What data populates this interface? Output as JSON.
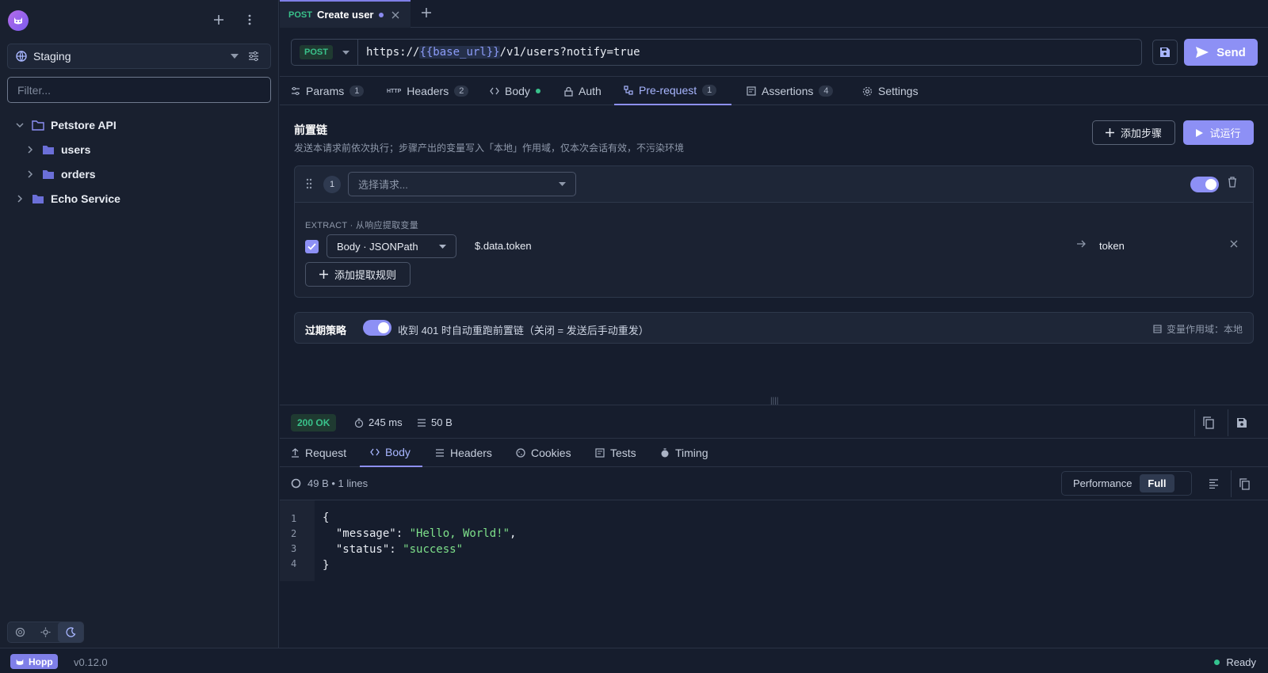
{
  "app": {
    "version": "v0.12.0",
    "brand": "Hopp",
    "status": "Ready"
  },
  "sidebar": {
    "environment": "Staging",
    "filter_placeholder": "Filter...",
    "tree": [
      {
        "label": "Petstore API"
      },
      {
        "label": "users"
      },
      {
        "label": "orders"
      },
      {
        "label": "Echo Service"
      }
    ]
  },
  "tab": {
    "method": "POST",
    "title": "Create user"
  },
  "request": {
    "method": "POST",
    "url_prefix": "https://",
    "url_var": "{{base_url}}",
    "url_suffix": "/v1/users?notify=true",
    "send_label": "Send"
  },
  "request_tabs": [
    {
      "label": "Params",
      "count": "1"
    },
    {
      "label": "Headers",
      "count": "2"
    },
    {
      "label": "Body"
    },
    {
      "label": "Auth"
    },
    {
      "label": "Pre-request",
      "count": "1"
    },
    {
      "label": "Assertions",
      "count": "4"
    },
    {
      "label": "Settings"
    }
  ],
  "prerequest": {
    "title": "前置链",
    "subtitle": "发送本请求前依次执行；步骤产出的变量写入「本地」作用域，仅本次会话有效，不污染环境",
    "add_step_label": "添加步骤",
    "dry_run_label": "试运行",
    "step": {
      "number": "1",
      "select_placeholder": "选择请求...",
      "enabled": true,
      "extract_label": "EXTRACT · 从响应提取变量",
      "rule": {
        "checked": true,
        "source": "Body · JSONPath",
        "path": "$.data.token",
        "variable": "token"
      },
      "add_rule_label": "添加提取规则"
    },
    "expiry": {
      "title": "过期策略",
      "enabled": true,
      "description": "收到 401 时自动重跑前置链（关闭 = 发送后手动重发）",
      "scope": "变量作用域：本地"
    }
  },
  "response": {
    "status": "200 OK",
    "time": "245 ms",
    "size": "50 B",
    "tabs": [
      {
        "label": "Request"
      },
      {
        "label": "Body"
      },
      {
        "label": "Headers"
      },
      {
        "label": "Cookies"
      },
      {
        "label": "Tests"
      },
      {
        "label": "Timing"
      }
    ],
    "body_info": "49 B • 1 lines",
    "view_modes": [
      "Performance",
      "Full"
    ],
    "active_view": "Full",
    "lines": [
      {
        "n": "1",
        "text": "{"
      },
      {
        "n": "2",
        "key": "  \"message\": ",
        "value": "\"Hello, World!\"",
        "tail": ","
      },
      {
        "n": "3",
        "key": "  \"status\": ",
        "value": "\"success\""
      },
      {
        "n": "4",
        "text": "}"
      }
    ]
  },
  "colors": {
    "accent": "#8d90f5",
    "success": "#39c28b",
    "background": "#161d2d"
  }
}
